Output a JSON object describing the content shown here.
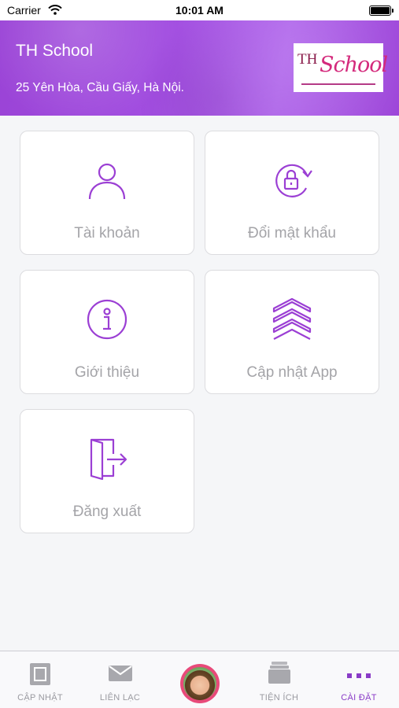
{
  "status_bar": {
    "carrier": "Carrier",
    "time": "10:01 AM"
  },
  "header": {
    "school_name": "TH School",
    "address": "25 Yên Hòa, Cầu Giấy, Hà Nội.",
    "logo": {
      "prefix": "TH",
      "word": "School"
    }
  },
  "menu": [
    {
      "label": "Tài khoản",
      "icon": "user-icon"
    },
    {
      "label": "Đổi mật khẩu",
      "icon": "lock-refresh-icon"
    },
    {
      "label": "Giới thiệu",
      "icon": "info-icon"
    },
    {
      "label": "Cập nhật App",
      "icon": "chevrons-up-icon"
    },
    {
      "label": "Đăng xuất",
      "icon": "logout-door-icon"
    }
  ],
  "tabbar": {
    "items": [
      {
        "label": "CẬP NHẬT",
        "icon": "notebook-icon"
      },
      {
        "label": "LIÊN LẠC",
        "icon": "mail-icon"
      },
      {
        "label": "",
        "icon": "avatar"
      },
      {
        "label": "TIỆN ÍCH",
        "icon": "stack-icon"
      },
      {
        "label": "CÀI ĐẶT",
        "icon": "more-dots-icon"
      }
    ],
    "active": "CÀI ĐẶT"
  },
  "colors": {
    "accent": "#9b3fd4",
    "header": "#a24ee0",
    "label": "#a4a4a8",
    "avatar_ring": "#e84a7a"
  }
}
